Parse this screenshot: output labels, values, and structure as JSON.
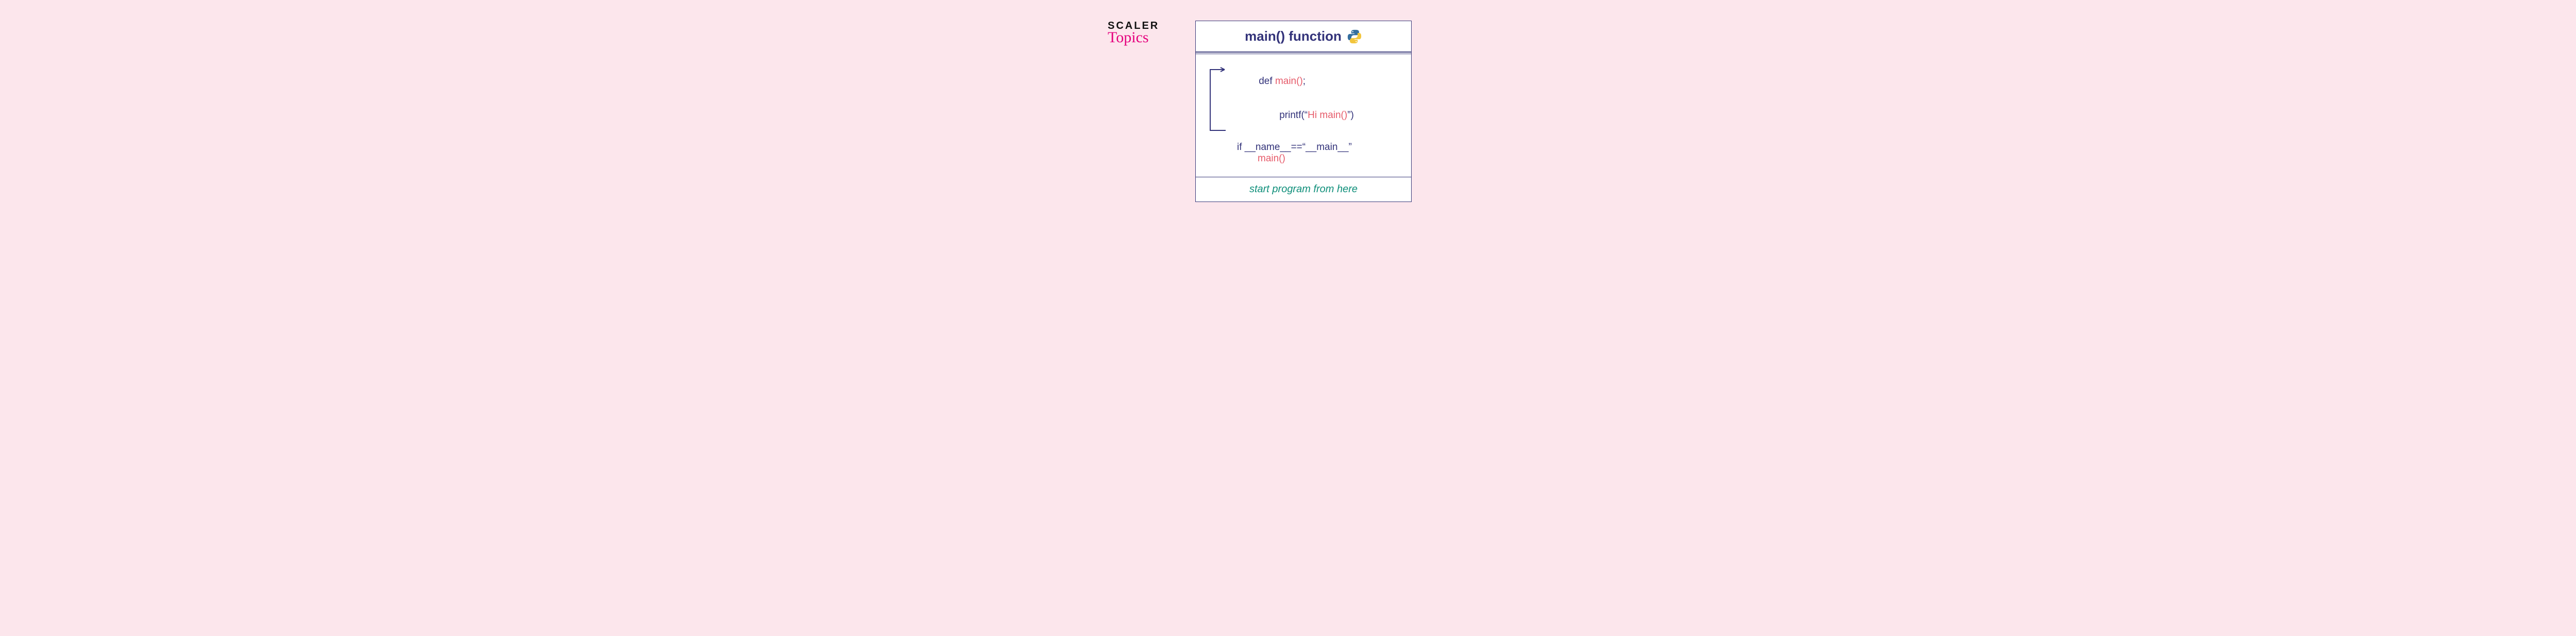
{
  "logo": {
    "line1": "SCALER",
    "line2": "Topics"
  },
  "card": {
    "title": "main() function",
    "icon_name": "python-logo-icon"
  },
  "code": {
    "line1_kw": "def ",
    "line1_fn": "main()",
    "line1_end": ";",
    "line2_pre": "printf(“",
    "line2_hl": "Hi main()",
    "line2_post": "”)",
    "line3": "if __name__==“__main__”",
    "line4": "main()"
  },
  "footer": "start program from here",
  "colors": {
    "bg": "#fce6ec",
    "border": "#3a3a7a",
    "text": "#33337a",
    "accent": "#e65b6a",
    "footer": "#0f8f7a",
    "brand_pink": "#e5007e"
  }
}
